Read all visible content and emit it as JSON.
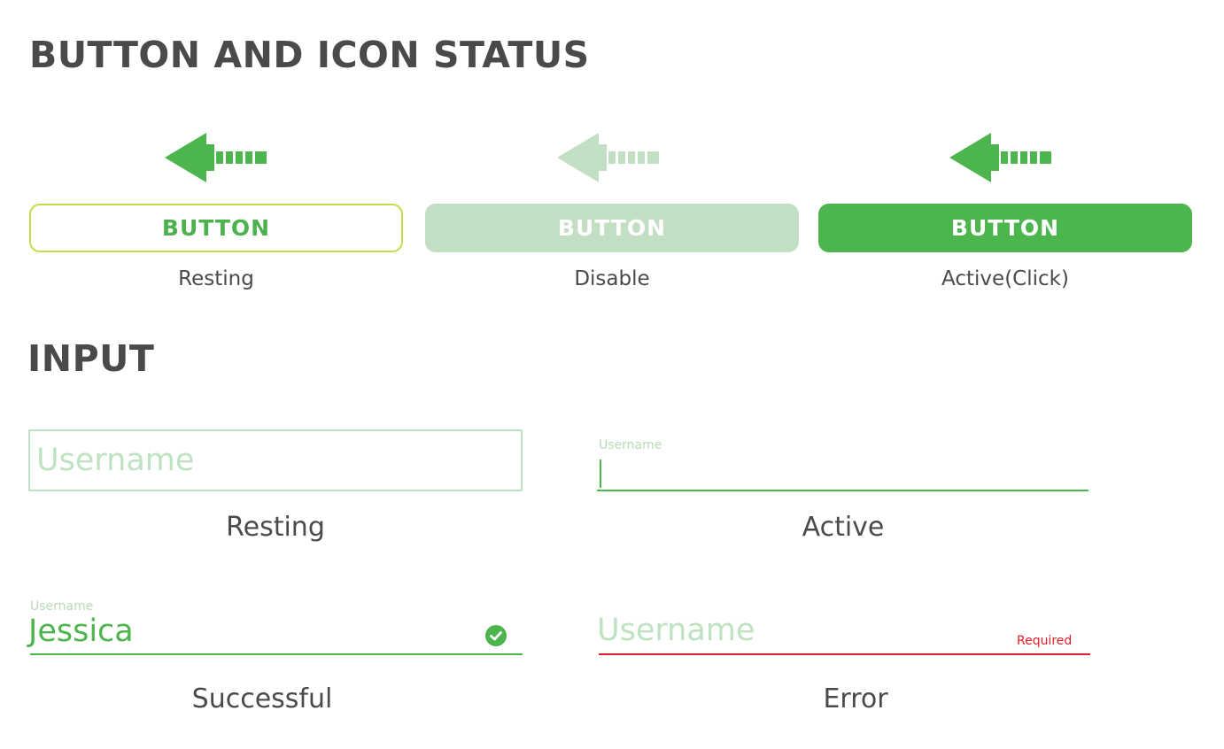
{
  "colors": {
    "green": "#4db54d",
    "green_light": "#c3dfc3",
    "lime_border": "#c5dc48",
    "error_red": "#e0202a",
    "text_dark": "#4a4a4a"
  },
  "buttons_section": {
    "title": "BUTTON AND ICON STATUS",
    "states": [
      {
        "icon": "arrow-left-icon",
        "label": "BUTTON",
        "caption": "Resting"
      },
      {
        "icon": "arrow-left-icon",
        "label": "BUTTON",
        "caption": "Disable"
      },
      {
        "icon": "arrow-left-icon",
        "label": "BUTTON",
        "caption": "Active(Click)"
      }
    ]
  },
  "input_section": {
    "title": "INPUT",
    "resting": {
      "placeholder": "Username",
      "caption": "Resting"
    },
    "active": {
      "label": "Username",
      "value": "",
      "caption": "Active"
    },
    "successful": {
      "label": "Username",
      "value": "Jessica",
      "icon": "check-circle-icon",
      "caption": "Successful"
    },
    "error": {
      "placeholder": "Username",
      "message": "Required",
      "caption": "Error"
    }
  }
}
